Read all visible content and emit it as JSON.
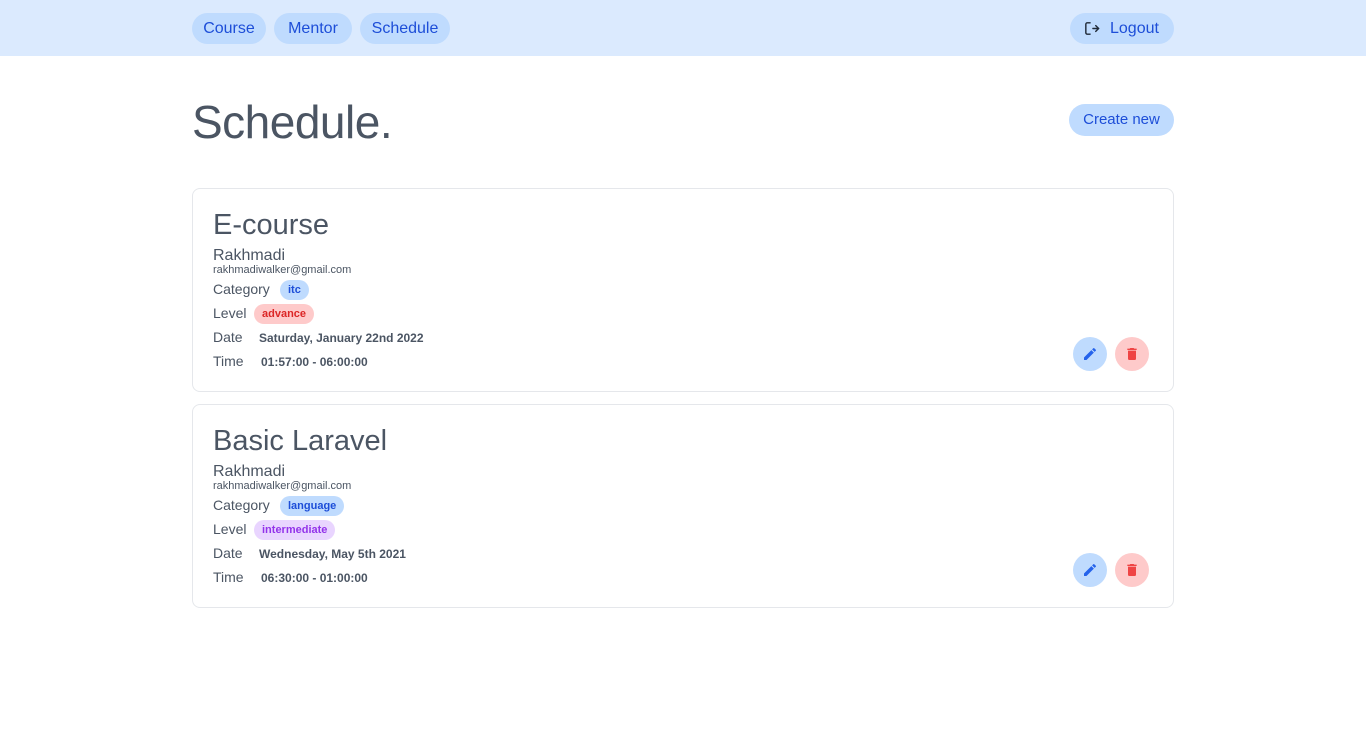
{
  "nav": {
    "items": [
      {
        "label": "Course"
      },
      {
        "label": "Mentor"
      },
      {
        "label": "Schedule"
      }
    ],
    "logout_label": "Logout"
  },
  "page": {
    "title": "Schedule.",
    "create_label": "Create new"
  },
  "labels": {
    "category": "Category",
    "level": "Level",
    "date": "Date",
    "time": "Time"
  },
  "schedules": [
    {
      "title": "E-course",
      "mentor_name": "Rakhmadi",
      "mentor_email": "rakhmadiwalker@gmail.com",
      "category": "itc",
      "level": "advance",
      "date": "Saturday, January 22nd 2022",
      "time": "01:57:00 - 06:00:00"
    },
    {
      "title": "Basic Laravel",
      "mentor_name": "Rakhmadi",
      "mentor_email": "rakhmadiwalker@gmail.com",
      "category": "language",
      "level": "intermediate",
      "date": "Wednesday, May 5th 2021",
      "time": "06:30:00 - 01:00:00"
    }
  ],
  "colors": {
    "nav_bg": "#dbeafe",
    "pill_bg": "#bfdbfe",
    "accent": "#1d4ed8",
    "delete_bg": "#fecaca",
    "delete_fg": "#ef4444",
    "level_advance": "#dc2626",
    "level_intermediate": "#9333ea"
  },
  "icons": {
    "logout": "logout-icon",
    "edit": "pencil-icon",
    "delete": "trash-icon"
  }
}
